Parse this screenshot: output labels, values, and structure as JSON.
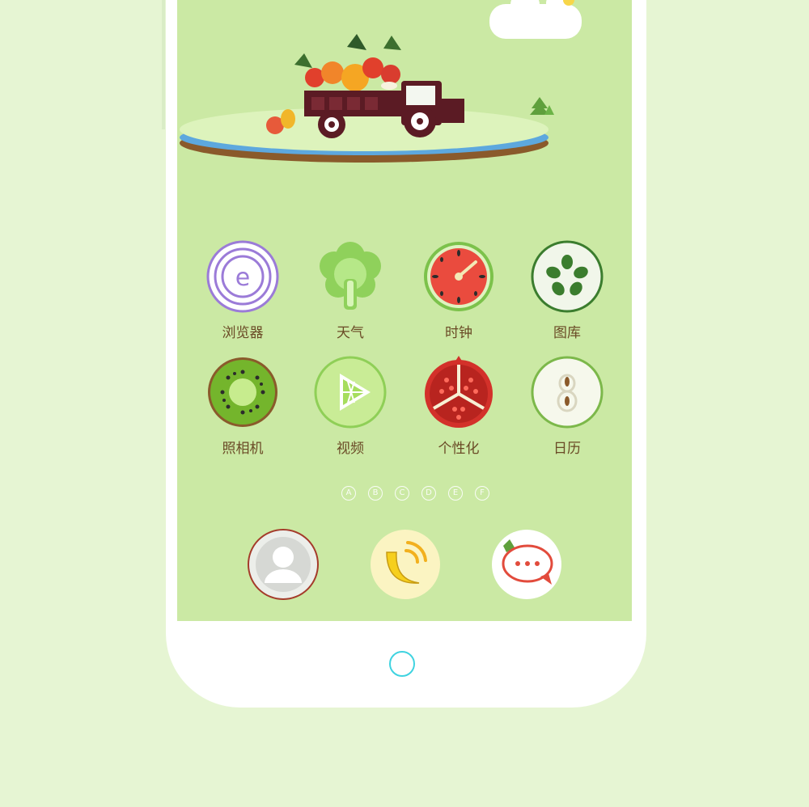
{
  "home_screen": {
    "apps": [
      {
        "label": "浏览器",
        "icon": "onion-browser-icon"
      },
      {
        "label": "天气",
        "icon": "broccoli-weather-icon"
      },
      {
        "label": "时钟",
        "icon": "watermelon-clock-icon"
      },
      {
        "label": "图库",
        "icon": "cucumber-gallery-icon"
      },
      {
        "label": "照相机",
        "icon": "kiwi-camera-icon"
      },
      {
        "label": "视频",
        "icon": "lime-video-icon"
      },
      {
        "label": "个性化",
        "icon": "pomegranate-theme-icon"
      },
      {
        "label": "日历",
        "icon": "pear-calendar-icon"
      }
    ],
    "page_indicators": [
      "A",
      "B",
      "C",
      "D",
      "E",
      "F"
    ],
    "dock": [
      {
        "icon": "contacts-icon"
      },
      {
        "icon": "banana-phone-icon"
      },
      {
        "icon": "messages-icon"
      }
    ]
  },
  "colors": {
    "background": "#e6f5d3",
    "screen": "#cbe9a4",
    "label": "#6a4a26",
    "home_button_ring": "#3fd3e0"
  }
}
